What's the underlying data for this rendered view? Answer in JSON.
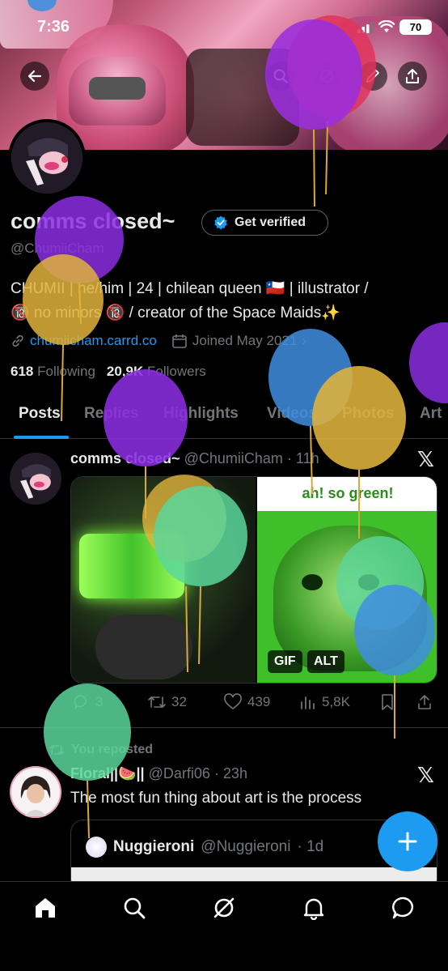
{
  "status_bar": {
    "time": "7:36",
    "battery": "70"
  },
  "profile": {
    "display_name": "comms closed~",
    "verify_button": "Get verified",
    "handle": "@ChumiiCham",
    "bio_line1": "CHUMII | he/him | 24 | chilean queen 🇨🇱 | illustrator /",
    "bio_line2": "🔞 no minors 🔞 / creator of the Space Maids✨",
    "website": "chumiicham.carrd.co",
    "joined": "Joined May 2021",
    "following_count": "618",
    "following_label": "Following",
    "followers_count": "20,9K",
    "followers_label": "Followers"
  },
  "tabs": [
    "Posts",
    "Replies",
    "Highlights",
    "Videos",
    "Photos",
    "Art"
  ],
  "post1": {
    "name": "comms closed~",
    "handle": "@ChumiiCham",
    "time": "· 11h",
    "right_image_caption": "ah! so green!",
    "badge_gif": "GIF",
    "badge_alt": "ALT",
    "replies": "3",
    "reposts": "32",
    "likes": "439",
    "views": "5,8K"
  },
  "post2": {
    "repost_label": "You reposted",
    "name": "Floral||🍉||",
    "handle": "@Darfi06",
    "time": "· 23h",
    "text": "The most fun thing about art is the process",
    "quote_name": "Nuggieroni",
    "quote_handle": "@Nuggieroni",
    "quote_time": "· 1d"
  },
  "fab_label": "+",
  "bottom_nav": [
    "home-icon",
    "search-icon",
    "grok-icon",
    "notifications-icon",
    "messages-icon"
  ],
  "colors": {
    "accent": "#1d9bf0",
    "text": "#e7e9ea",
    "muted": "#71767b",
    "border": "#2f3336",
    "background": "#000000"
  }
}
